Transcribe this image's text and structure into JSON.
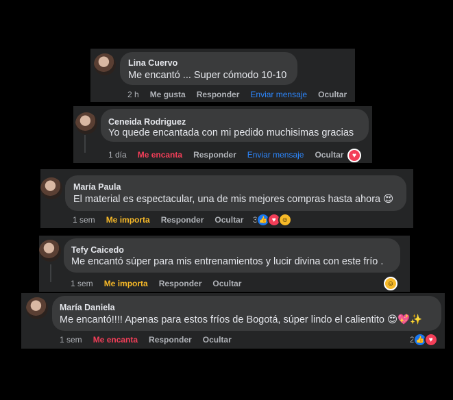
{
  "comments": [
    {
      "name": "Lina Cuervo",
      "text": "Me encantó ... Super cómodo 10-10",
      "time": "2 h",
      "reaction_label": "Me gusta",
      "reply": "Responder",
      "message": "Enviar mensaje",
      "hide": "Ocultar"
    },
    {
      "name": "Ceneida Rodriguez",
      "text": "Yo quede encantada con mi pedido muchisimas gracias",
      "time": "1 día",
      "reaction_label": "Me encanta",
      "reply": "Responder",
      "message": "Enviar mensaje",
      "hide": "Ocultar"
    },
    {
      "name": "María Paula",
      "text": "El material es espectacular, una de mis mejores compras hasta ahora 😍",
      "time": "1 sem",
      "reaction_label": "Me importa",
      "reply": "Responder",
      "hide": "Ocultar",
      "reaction_count": "3"
    },
    {
      "name": "Tefy Caicedo",
      "text": "Me encantó súper para mis entrenamientos y lucir divina con este frío .",
      "time": "1 sem",
      "reaction_label": "Me importa",
      "reply": "Responder",
      "hide": "Ocultar"
    },
    {
      "name": "María Daniela",
      "text": "Me encantó!!!! Apenas para estos fríos de Bogotá, súper lindo el calientito 😍💖✨",
      "time": "1 sem",
      "reaction_label": "Me encanta",
      "reply": "Responder",
      "hide": "Ocultar",
      "reaction_count": "2"
    }
  ],
  "icons": {
    "like": "like-reaction-icon",
    "love": "love-reaction-icon",
    "care": "care-reaction-icon"
  },
  "colors": {
    "background": "#000000",
    "card": "#242526",
    "bubble": "#3a3b3c",
    "text": "#e4e6eb",
    "muted": "#b0b3b8",
    "link_blue": "#2d88ff",
    "love_red": "#f33e58",
    "care_yellow": "#f7b928"
  }
}
